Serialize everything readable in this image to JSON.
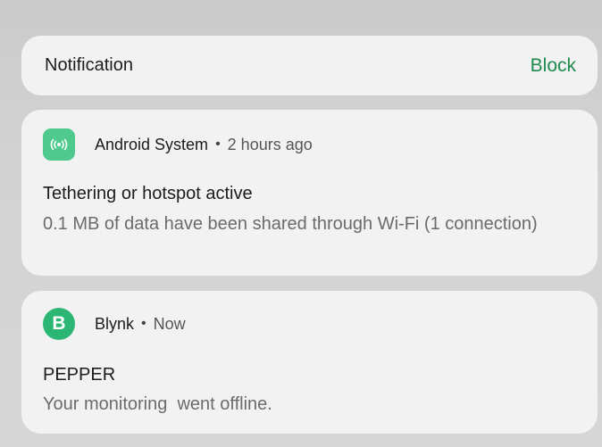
{
  "header": {
    "title": "Notification",
    "block_label": "Block"
  },
  "notifications": [
    {
      "app": "Android System",
      "separator": "•",
      "time": "2 hours ago",
      "icon": "hotspot-icon",
      "title": "Tethering or hotspot active",
      "body": "0.1 MB of data have been shared through Wi-Fi (1 connection)"
    },
    {
      "app": "Blynk",
      "separator": "•",
      "time": "Now",
      "icon": "blynk-b-icon",
      "icon_letter": "B",
      "title": "PEPPER",
      "body": "Your monitoring  went offline."
    }
  ],
  "colors": {
    "accent": "#1e8a4e",
    "android_icon": "#4fc98c",
    "blynk_icon": "#2bb673",
    "card": "#f2f2f2"
  }
}
